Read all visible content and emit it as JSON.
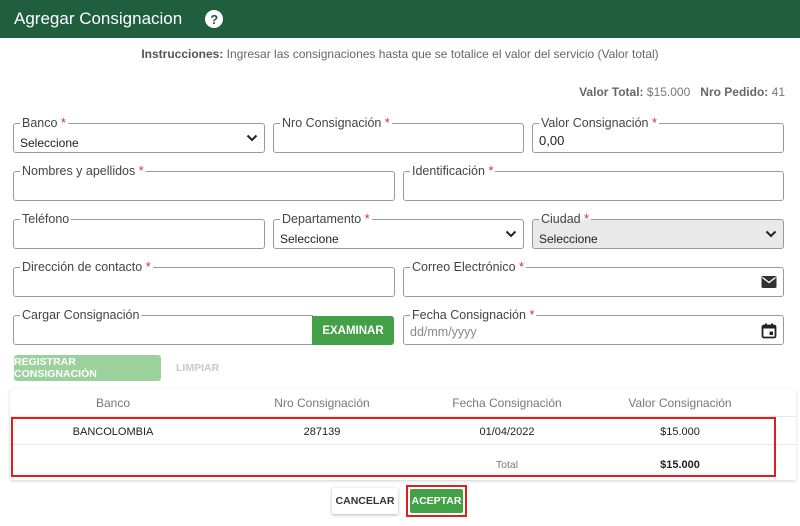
{
  "header": {
    "title": "Agregar Consignacion",
    "help_icon": "?"
  },
  "instructions": {
    "label": "Instrucciones:",
    "text": " Ingresar las consignaciones hasta que se totalice el valor del servicio (Valor total)"
  },
  "totals": {
    "valor_total_label": "Valor Total:",
    "valor_total": "$15.000",
    "nro_pedido_label": "Nro Pedido:",
    "nro_pedido": "41"
  },
  "form": {
    "banco": {
      "label": "Banco",
      "value": "Seleccione"
    },
    "nro_consignacion": {
      "label": "Nro Consignación",
      "value": ""
    },
    "valor_consignacion": {
      "label": "Valor Consignación",
      "value": "0,00"
    },
    "nombres": {
      "label": "Nombres y apellidos",
      "value": ""
    },
    "identificacion": {
      "label": "Identificación",
      "value": ""
    },
    "telefono": {
      "label": "Teléfono",
      "value": ""
    },
    "departamento": {
      "label": "Departamento",
      "value": "Seleccione"
    },
    "ciudad": {
      "label": "Ciudad",
      "value": "Seleccione"
    },
    "direccion": {
      "label": "Dirección de contacto",
      "value": ""
    },
    "correo": {
      "label": "Correo Electrónico",
      "value": ""
    },
    "cargar": {
      "label": "Cargar Consignación",
      "button": "EXAMINAR"
    },
    "fecha": {
      "label": "Fecha Consignación",
      "placeholder": "dd/mm/yyyy"
    },
    "required_mark": "*"
  },
  "actions": {
    "registrar": "REGISTRAR CONSIGNACIÓN",
    "limpiar": "LIMPIAR"
  },
  "table": {
    "headers": [
      "Banco",
      "Nro Consignación",
      "Fecha Consignación",
      "Valor Consignación"
    ],
    "rows": [
      [
        "BANCOLOMBIA",
        "287139",
        "01/04/2022",
        "$15.000"
      ]
    ],
    "total_label": "Total",
    "total_value": "$15.000"
  },
  "footer": {
    "cancelar": "CANCELAR",
    "aceptar": "ACEPTAR"
  },
  "colors": {
    "header": "#1f5e3e",
    "primary": "#43a047",
    "required": "#d32f2f",
    "highlight": "#e01e1e"
  }
}
